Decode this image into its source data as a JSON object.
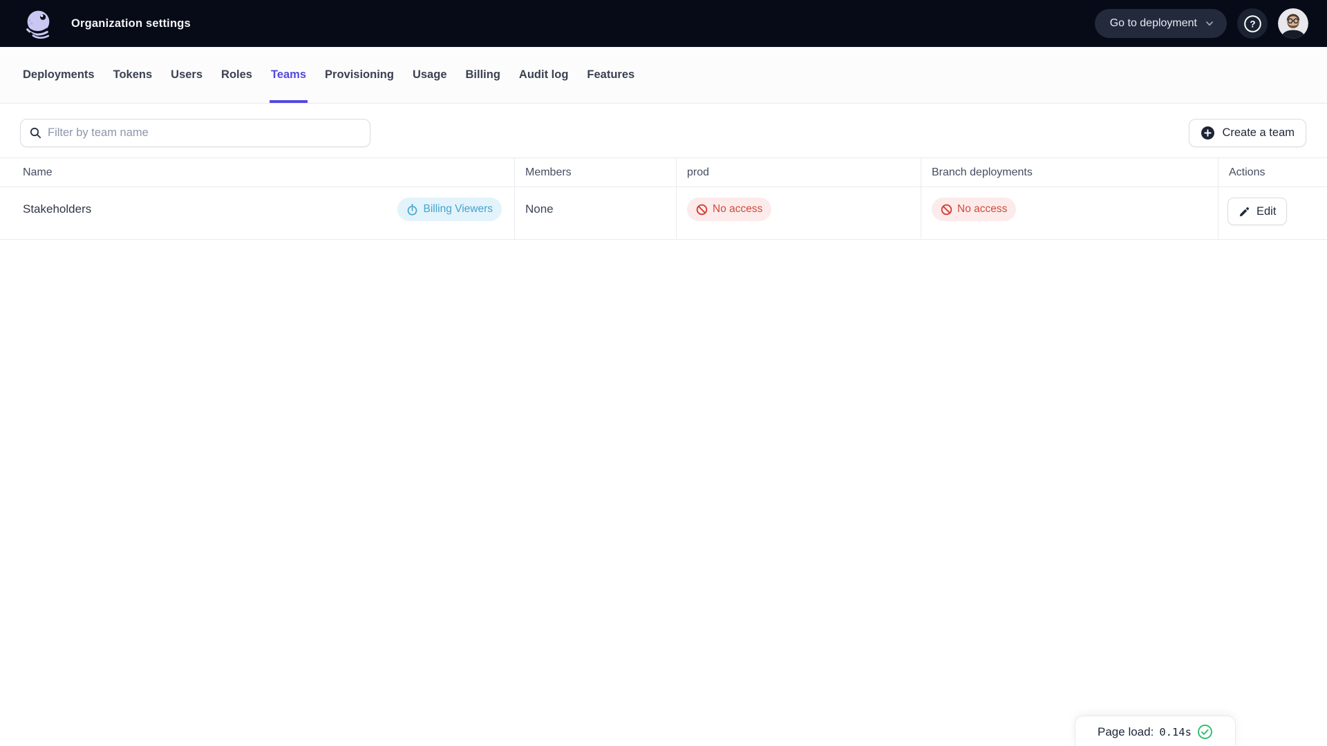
{
  "header": {
    "title": "Organization settings",
    "go_to_deployment": "Go to deployment"
  },
  "nav": {
    "tabs": [
      {
        "label": "Deployments",
        "active": false
      },
      {
        "label": "Tokens",
        "active": false
      },
      {
        "label": "Users",
        "active": false
      },
      {
        "label": "Roles",
        "active": false
      },
      {
        "label": "Teams",
        "active": true
      },
      {
        "label": "Provisioning",
        "active": false
      },
      {
        "label": "Usage",
        "active": false
      },
      {
        "label": "Billing",
        "active": false
      },
      {
        "label": "Audit log",
        "active": false
      },
      {
        "label": "Features",
        "active": false
      }
    ]
  },
  "toolbar": {
    "filter_placeholder": "Filter by team name",
    "create_team": "Create a team"
  },
  "table": {
    "columns": [
      "Name",
      "Members",
      "prod",
      "Branch deployments",
      "Actions"
    ],
    "rows": [
      {
        "name": "Stakeholders",
        "badge": "Billing Viewers",
        "members": "None",
        "prod": "No access",
        "branch_deployments": "No access",
        "action": "Edit"
      }
    ]
  },
  "status_bar": {
    "page_load_label": "Page load:",
    "page_load_value": "0.14s"
  },
  "icons": [
    "octopus-logo-icon",
    "chevron-down-icon",
    "help-icon",
    "search-icon",
    "plus-circle-icon",
    "stopwatch-icon",
    "no-entry-icon",
    "pencil-icon",
    "check-circle-icon"
  ],
  "colors": {
    "accent": "#5448e0",
    "header-bg": "#070b17",
    "info-badge-bg": "#e3f3fb",
    "info-badge-text": "#44a3cc",
    "danger-badge-bg": "#fcebea",
    "danger-badge-text": "#d04a3c",
    "success": "#2dbd6e"
  }
}
